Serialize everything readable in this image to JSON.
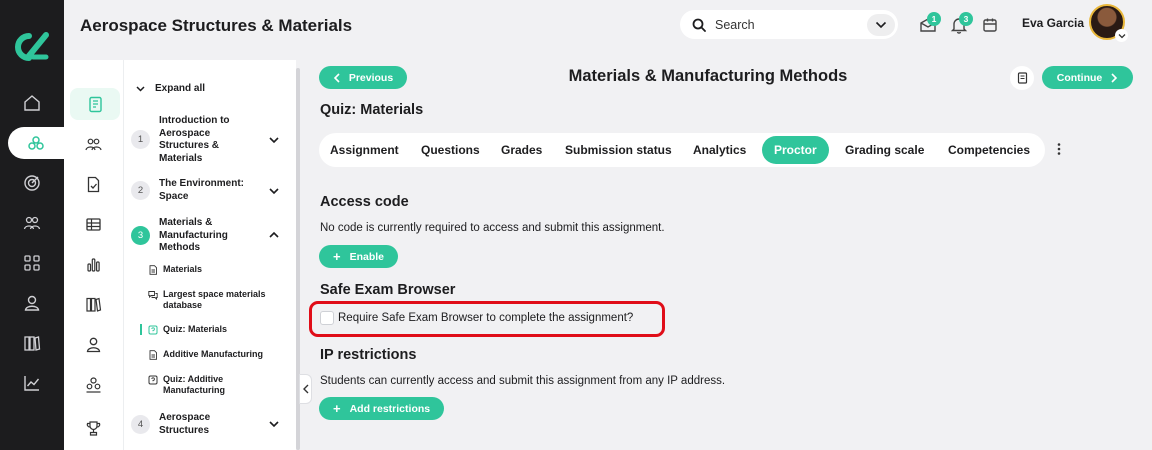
{
  "app": {
    "title": "Aerospace Structures & Materials"
  },
  "search": {
    "placeholder": "Search"
  },
  "notifications": {
    "inbox_count": "1",
    "bell_count": "3"
  },
  "user": {
    "name": "Eva Garcia"
  },
  "outline": {
    "expand_all": "Expand all",
    "modules": [
      {
        "num": "1",
        "title": "Introduction to Aerospace Structures & Materials"
      },
      {
        "num": "2",
        "title": "The Environment: Space"
      },
      {
        "num": "3",
        "title": "Materials & Manufacturing Methods"
      },
      {
        "num": "4",
        "title": "Aerospace Structures"
      }
    ],
    "items": [
      {
        "label": "Materials",
        "icon": "document-icon"
      },
      {
        "label": "Largest space materials database",
        "icon": "chat-icon"
      },
      {
        "label": "Quiz: Materials",
        "icon": "quiz-icon"
      },
      {
        "label": "Additive Manufacturing",
        "icon": "document-icon"
      },
      {
        "label": "Quiz: Additive Manufacturing",
        "icon": "quiz-icon"
      }
    ]
  },
  "nav": {
    "previous": "Previous",
    "continue": "Continue"
  },
  "page": {
    "title": "Materials & Manufacturing Methods",
    "subtitle": "Quiz: Materials"
  },
  "tabs": [
    "Assignment",
    "Questions",
    "Grades",
    "Submission status",
    "Analytics",
    "Proctor",
    "Grading scale",
    "Competencies"
  ],
  "active_tab": "Proctor",
  "access_code": {
    "title": "Access code",
    "text": "No code is currently required to access and submit this assignment.",
    "button": "Enable"
  },
  "seb": {
    "title": "Safe Exam Browser",
    "checkbox_label": "Require Safe Exam Browser to complete the assignment?",
    "checked": false
  },
  "ip": {
    "title": "IP restrictions",
    "text": "Students can currently access and submit this assignment from any IP address.",
    "button": "Add restrictions"
  },
  "colors": {
    "accent": "#2fc59b",
    "rail": "#1c1c1e",
    "highlight": "#e00d18"
  }
}
